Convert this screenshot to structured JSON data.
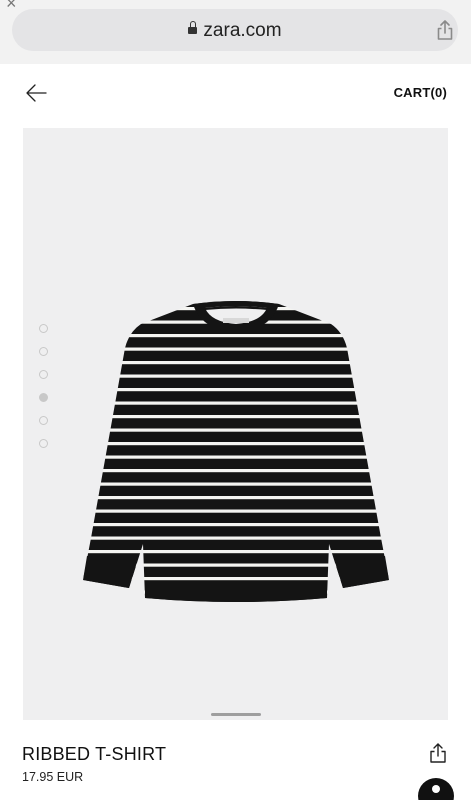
{
  "browser": {
    "url": "zara.com"
  },
  "header": {
    "cart_label": "CART(0)"
  },
  "gallery": {
    "total_images": 6,
    "active_index": 3
  },
  "product": {
    "name": "RIBBED T-SHIRT",
    "price": "17.95 EUR"
  },
  "icons": {
    "close": "close-icon",
    "lock": "lock-icon",
    "share": "share-icon",
    "back": "arrow-left-icon",
    "chat": "chat-icon"
  },
  "colors": {
    "image_bg": "#efeff0",
    "shirt": "#141414",
    "stripe": "#f5f5f2"
  }
}
